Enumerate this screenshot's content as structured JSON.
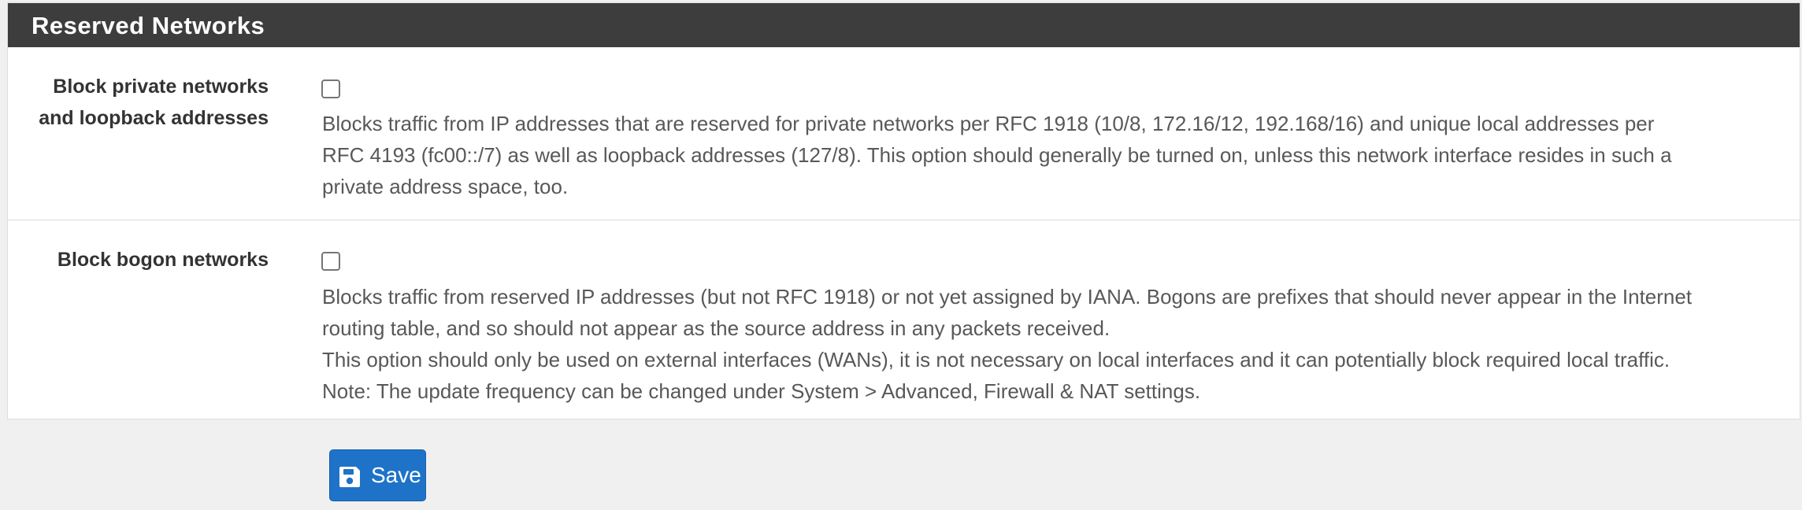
{
  "section": {
    "title": "Reserved Networks"
  },
  "block_private": {
    "label_line1": "Block private networks",
    "label_line2": "and loopback addresses",
    "checked": false,
    "help": [
      "Blocks traffic from IP addresses that are reserved for private networks per RFC 1918 (10/8, 172.16/12, 192.168/16) and unique local addresses per",
      "RFC 4193 (fc00::/7) as well as loopback addresses (127/8). This option should generally be turned on, unless this network interface resides in such a",
      "private address space, too."
    ]
  },
  "block_bogon": {
    "label": "Block bogon networks",
    "checked": false,
    "help": [
      "Blocks traffic from reserved IP addresses (but not RFC 1918) or not yet assigned by IANA. Bogons are prefixes that should never appear in the Internet",
      "routing table, and so should not appear as the source address in any packets received.",
      "This option should only be used on external interfaces (WANs), it is not necessary on local interfaces and it can potentially block required local traffic.",
      "Note: The update frequency can be changed under System > Advanced, Firewall & NAT settings."
    ]
  },
  "actions": {
    "save_label": "Save",
    "save_icon": "floppy-disk-icon",
    "primary_color": "#1e73c8"
  }
}
